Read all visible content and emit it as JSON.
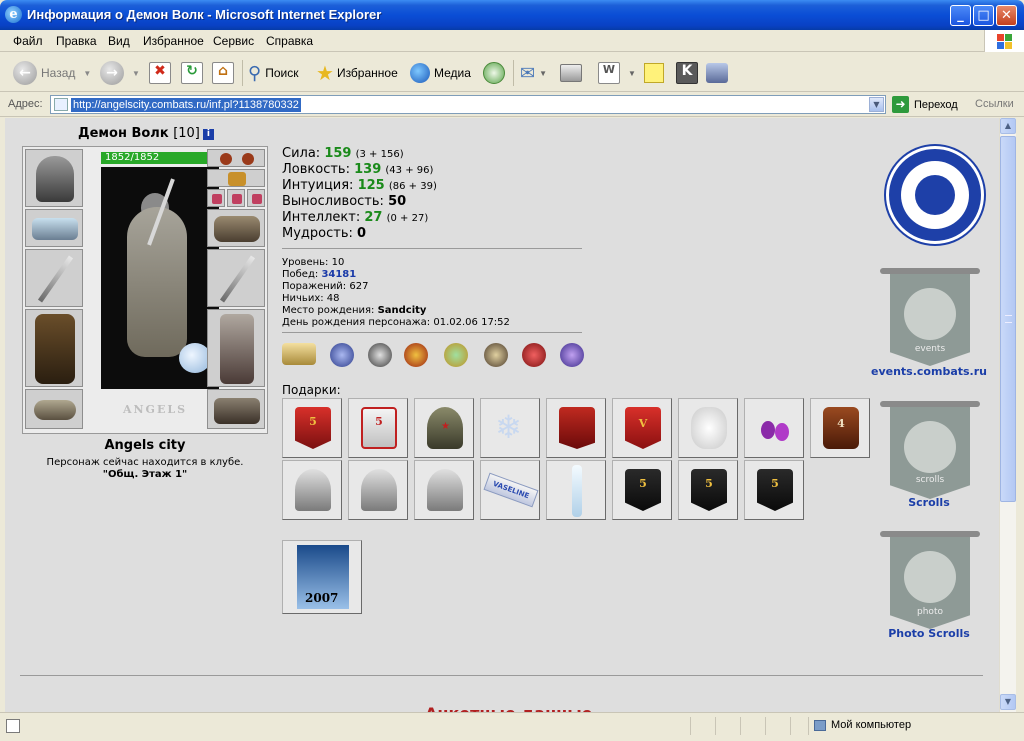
{
  "window": {
    "title": "Информация о Демон Волк - Microsoft Internet Explorer",
    "minimize": "_",
    "maximize": "□",
    "close": "✕"
  },
  "menu": [
    "Файл",
    "Правка",
    "Вид",
    "Избранное",
    "Сервис",
    "Справка"
  ],
  "toolbar": {
    "back": "Назад",
    "search": "Поиск",
    "favorites": "Избранное",
    "media": "Медиа"
  },
  "address": {
    "label": "Адрес:",
    "url": "http://angelscity.combats.ru/inf.pl?1138780332",
    "go": "Переход",
    "links": "Ссылки"
  },
  "character": {
    "name": "Демон Волк",
    "level": "[10]",
    "info_icon": "i",
    "hp": "1852/1852",
    "crest": "ANGELS",
    "city": "Angels city",
    "location_text": "Персонаж сейчас находится в клубе.",
    "room": "\"Общ. Этаж 1\""
  },
  "stats": [
    {
      "label": "Сила:",
      "value": "159",
      "detail": "(3 + 156)",
      "green": true
    },
    {
      "label": "Ловкость:",
      "value": "139",
      "detail": "(43 + 96)",
      "green": true
    },
    {
      "label": "Интуиция:",
      "value": "125",
      "detail": "(86 + 39)",
      "green": true
    },
    {
      "label": "Выносливость:",
      "value": "50",
      "detail": "",
      "green": false
    },
    {
      "label": "Интеллект:",
      "value": "27",
      "detail": "(0 + 27)",
      "green": true
    },
    {
      "label": "Мудрость:",
      "value": "0",
      "detail": "",
      "green": false
    }
  ],
  "info": {
    "level_label": "Уровень:",
    "level": "10",
    "wins_label": "Побед:",
    "wins": "34181",
    "losses_label": "Поражений:",
    "losses": "627",
    "draws_label": "Ничьих:",
    "draws": "48",
    "birthplace_label": "Место рождения:",
    "birthplace": "Sandcity",
    "birthday_label": "День рождения персонажа:",
    "birthday": "01.02.06 17:52"
  },
  "gifts_label": "Подарки:",
  "gift_texts": {
    "five": "5",
    "v": "V",
    "four": "4",
    "vaseline": "VASELINE",
    "year": "2007"
  },
  "banners": {
    "events_word": "events",
    "events_link": "events.combats.ru",
    "scrolls_word": "scrolls",
    "scrolls_link": "Scrolls",
    "photo_word": "photo",
    "photo_link": "Photo Scrolls"
  },
  "anketa": "Анкетные данные",
  "status": {
    "zone": "Мой компьютер"
  }
}
